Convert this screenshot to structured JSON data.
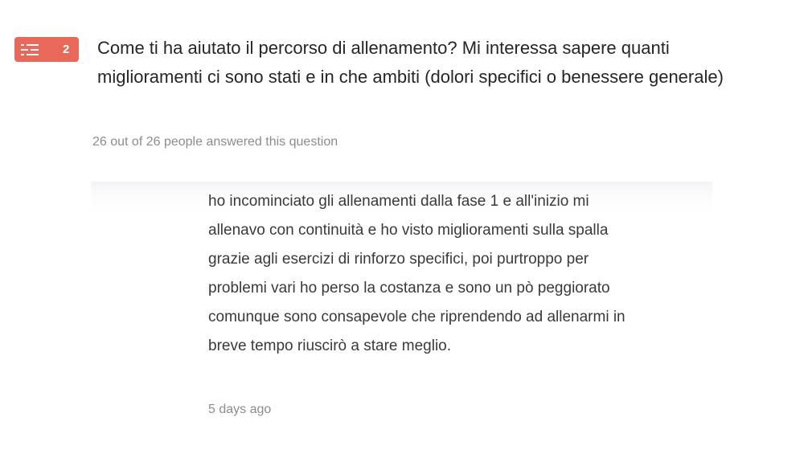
{
  "question": {
    "number": "2",
    "icon": "list-text-icon",
    "badge_color": "#e8685a",
    "title": "Come ti ha aiutato il percorso di allenamento? Mi interessa sapere quanti miglioramenti ci sono stati e in che ambiti (dolori specifici o benessere generale)",
    "responses_text": "26 out of 26 people answered this question"
  },
  "answer": {
    "text": "ho incominciato gli allenamenti dalla fase 1 e all'inizio mi allenavo con continuità e ho visto miglioramenti sulla spalla grazie agli esercizi di rinforzo specifici, poi purtroppo per problemi vari ho perso la costanza e sono un pò peggiorato comunque sono consapevole che riprendendo ad allenarmi in breve tempo riuscirò a stare meglio.",
    "time_ago": "5 days ago"
  }
}
